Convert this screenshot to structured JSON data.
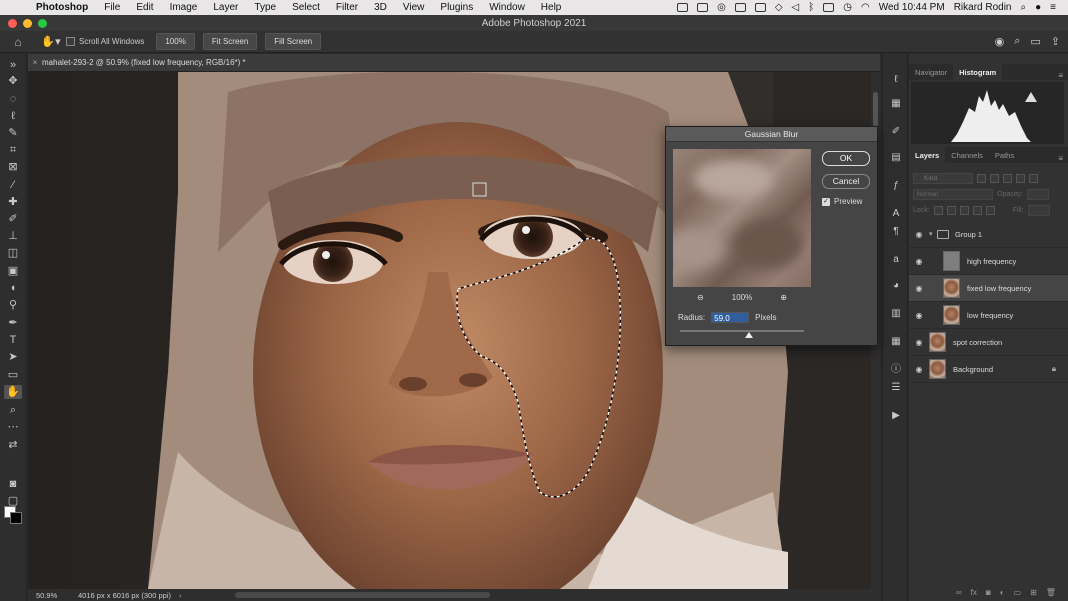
{
  "menubar": {
    "app_name": "Photoshop",
    "items": [
      "File",
      "Edit",
      "Image",
      "Layer",
      "Type",
      "Select",
      "Filter",
      "3D",
      "View",
      "Plugins",
      "Window",
      "Help"
    ],
    "clock": "Wed 10:44 PM",
    "user": "Rikard Rodin"
  },
  "window": {
    "title": "Adobe Photoshop 2021"
  },
  "options_bar": {
    "scroll_all_label": "Scroll All Windows",
    "zoom_button": "100%",
    "fit_screen_button": "Fit Screen",
    "fill_screen_button": "Fill Screen"
  },
  "document": {
    "tab_title": "mahalet-293-2 @ 50.9% (fixed low frequency, RGB/16*) *",
    "zoom": "50.9%",
    "doc_size": "4016 px x 6016 px (300 ppi)"
  },
  "panels": {
    "top_tabs": [
      "Navigator",
      "Histogram"
    ],
    "top_active": "Histogram",
    "layer_tabs": [
      "Layers",
      "Channels",
      "Paths"
    ],
    "layer_active": "Layers",
    "kind_placeholder": "Kind",
    "blend_mode": "Normal",
    "opacity_label": "Opacity:",
    "lock_label": "Lock:",
    "fill_label": "Fill:"
  },
  "layers": [
    {
      "name": "Group 1",
      "type": "group",
      "indent": 0,
      "selected": false,
      "locked": false
    },
    {
      "name": "high frequency",
      "type": "gray",
      "indent": 1,
      "selected": false,
      "locked": false
    },
    {
      "name": "fixed low frequency",
      "type": "face",
      "indent": 1,
      "selected": true,
      "locked": false
    },
    {
      "name": "low frequency",
      "type": "face",
      "indent": 1,
      "selected": false,
      "locked": false
    },
    {
      "name": "spot correction",
      "type": "face",
      "indent": 0,
      "selected": false,
      "locked": false
    },
    {
      "name": "Background",
      "type": "face",
      "indent": 0,
      "selected": false,
      "locked": true
    }
  ],
  "dialog": {
    "title": "Gaussian Blur",
    "ok_label": "OK",
    "cancel_label": "Cancel",
    "preview_label": "Preview",
    "preview_checked": true,
    "zoom_value": "100%",
    "radius_label": "Radius:",
    "radius_value": "59.0",
    "radius_unit": "Pixels",
    "slider_fraction": 0.56
  }
}
